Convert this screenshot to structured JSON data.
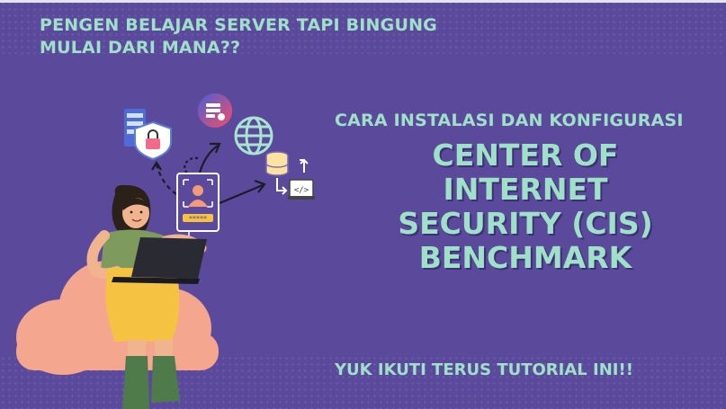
{
  "tagline": {
    "line1": "PENGEN BELAJAR SERVER TAPI BINGUNG",
    "line2": "MULAI DARI MANA??"
  },
  "subtitle": "CARA INSTALASI DAN KONFIGURASI",
  "title": {
    "line1": "CENTER OF INTERNET",
    "line2": "SECURITY (CIS)",
    "line3": "BENCHMARK"
  },
  "cta": "YUK IKUTI TERUS TUTORIAL INI!!",
  "colors": {
    "background": "#5b4a9c",
    "text_accent": "#9fe0c8",
    "cloud": "#f4a68f",
    "skirt": "#f5c242",
    "shirt": "#7e9a5c"
  },
  "icons": [
    "server-icon",
    "lock-shield-icon",
    "database-settings-icon",
    "globe-icon",
    "database-icon",
    "code-window-icon",
    "user-login-card-icon",
    "laptop-icon"
  ]
}
